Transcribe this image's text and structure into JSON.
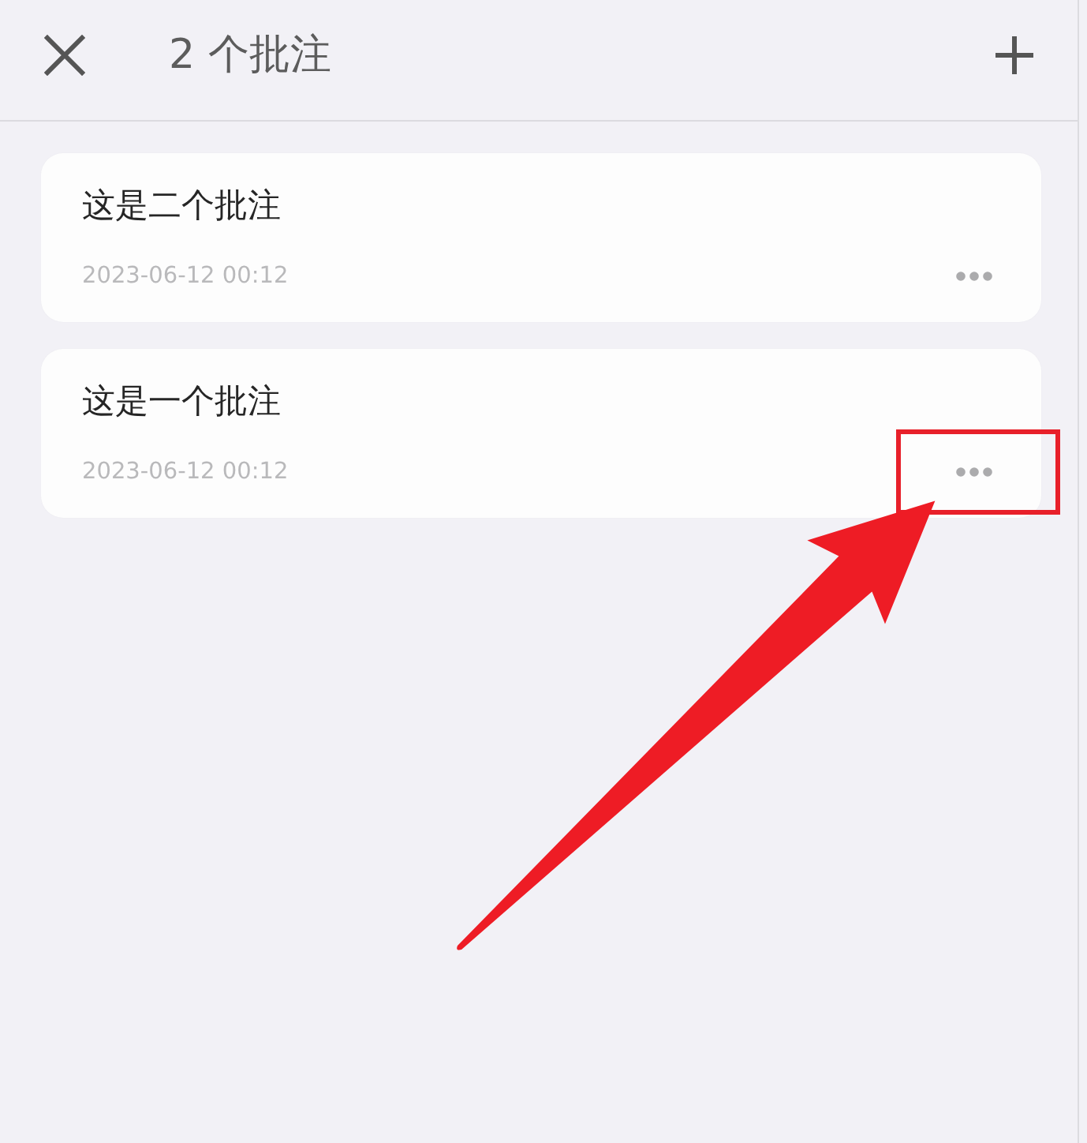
{
  "header": {
    "title": "2 个批注"
  },
  "notes": [
    {
      "text": "这是二个批注",
      "time": "2023-06-12 00:12",
      "highlighted": false
    },
    {
      "text": "这是一个批注",
      "time": "2023-06-12 00:12",
      "highlighted": true
    }
  ]
}
